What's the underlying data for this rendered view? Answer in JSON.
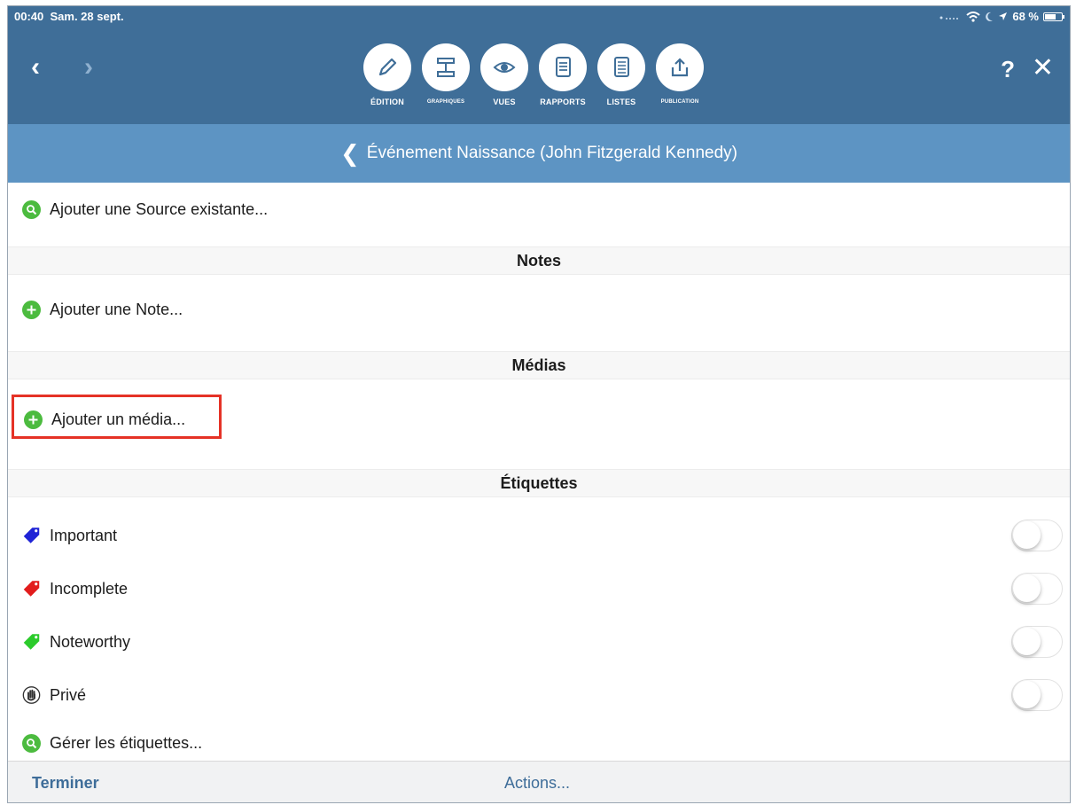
{
  "status": {
    "time": "00:40",
    "date": "Sam. 28 sept.",
    "battery": "68 %",
    "battery_level": 0.68
  },
  "toolbar": [
    {
      "label": "ÉDITION",
      "icon": "pencil-icon"
    },
    {
      "label": "GRAPHIQUES",
      "icon": "chart-icon"
    },
    {
      "label": "VUES",
      "icon": "eye-icon"
    },
    {
      "label": "RAPPORTS",
      "icon": "report-icon"
    },
    {
      "label": "LISTES",
      "icon": "list-icon"
    },
    {
      "label": "PUBLICATION",
      "icon": "upload-icon"
    }
  ],
  "nav": {
    "back": "‹",
    "forward": "›",
    "help": "?",
    "close": "✕"
  },
  "subheader": {
    "title": "Événement Naissance (John Fitzgerald Kennedy)"
  },
  "content": {
    "add_source": "Ajouter une Source existante...",
    "notes_header": "Notes",
    "add_note": "Ajouter une Note...",
    "media_header": "Médias",
    "add_media": "Ajouter un média...",
    "labels_header": "Étiquettes",
    "tags": [
      {
        "name": "Important",
        "color": "#1f23d6",
        "on": false
      },
      {
        "name": "Incomplete",
        "color": "#e21c1c",
        "on": false
      },
      {
        "name": "Noteworthy",
        "color": "#2bcb2b",
        "on": false
      },
      {
        "name": "Privé",
        "color": "#333333",
        "on": false
      }
    ],
    "manage_tags": "Gérer les étiquettes..."
  },
  "bottom": {
    "done": "Terminer",
    "actions": "Actions..."
  },
  "colors": {
    "header": "#3f6e98",
    "subheader": "#5d94c3",
    "accent": "#3e6d99",
    "green": "#4cbb3f",
    "highlight": "#e53226"
  }
}
